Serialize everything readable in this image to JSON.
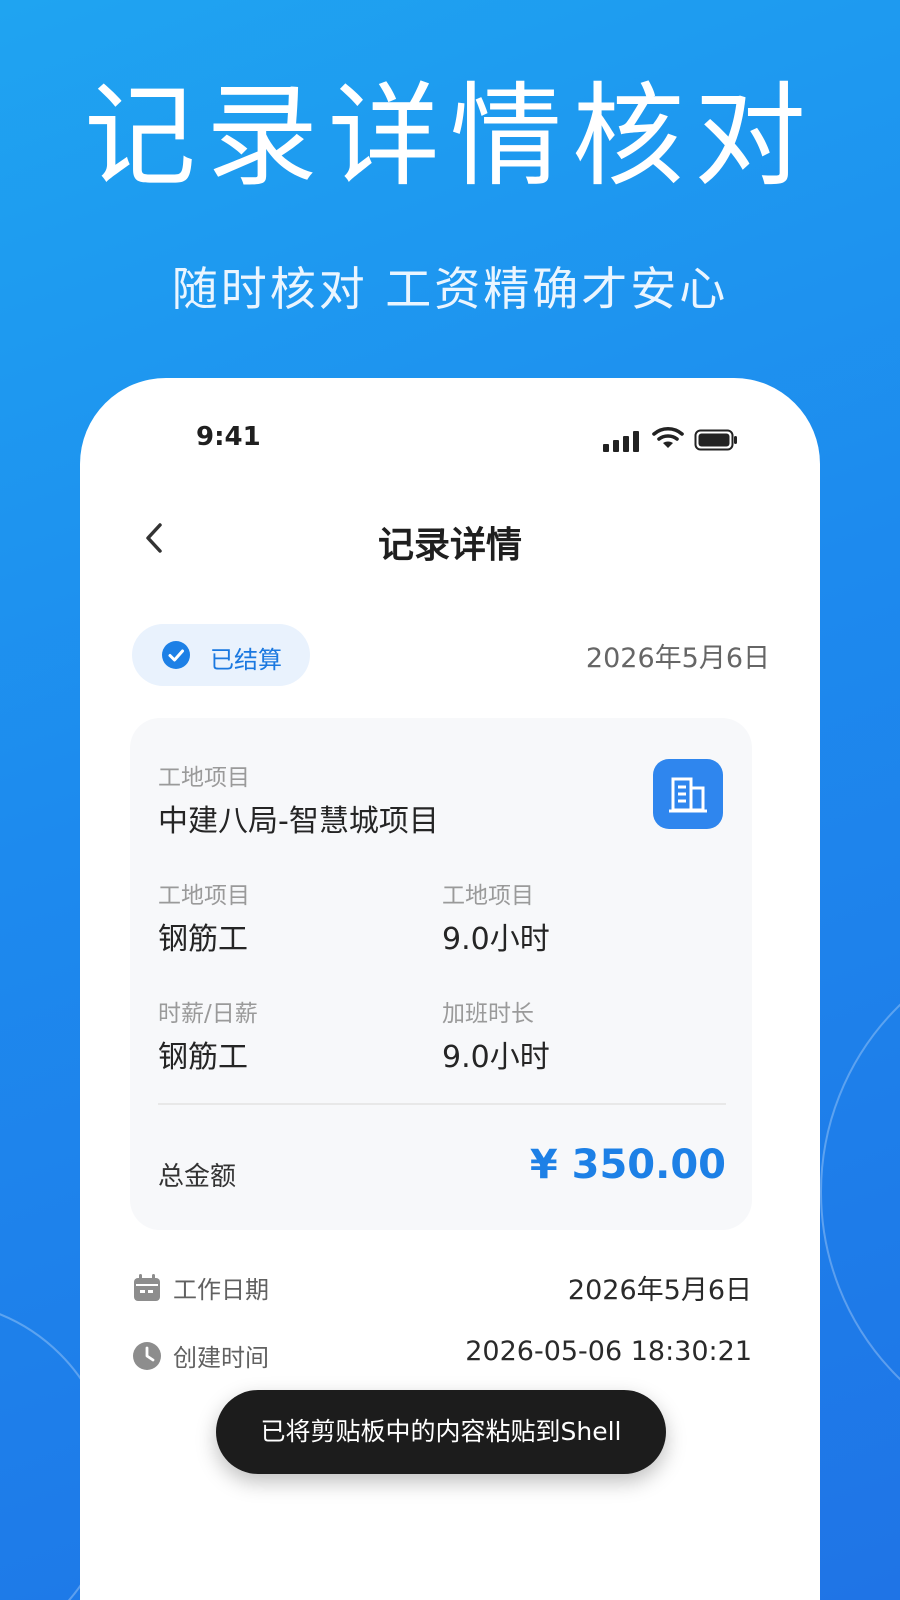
{
  "headline": "记录详情核对",
  "subheadline": "随时核对 工资精确才安心",
  "status_bar": {
    "time": "9:41",
    "icons": [
      "cellular-signal-icon",
      "wifi-icon",
      "battery-icon"
    ]
  },
  "nav": {
    "title": "记录详情",
    "back_icon": "chevron-left-icon"
  },
  "record": {
    "status_badge": "已结算",
    "status_icon": "check-circle-icon",
    "date": "2026年5月6日",
    "project_label": "工地项目",
    "project_name": "中建八局-智慧城项目",
    "project_icon": "building-icon",
    "fields": [
      {
        "label": "工地项目",
        "value": "钢筋工"
      },
      {
        "label": "工地项目",
        "value": "9.0小时"
      },
      {
        "label": "时薪/日薪",
        "value": "钢筋工"
      },
      {
        "label": "加班时长",
        "value": "9.0小时"
      }
    ],
    "total_label": "总金额",
    "total_value": "¥ 350.00"
  },
  "details": [
    {
      "icon": "calendar-icon",
      "label": "工作日期",
      "value": "2026年5月6日"
    },
    {
      "icon": "clock-icon",
      "label": "创建时间",
      "value": "2026-05-06 18:30:21"
    }
  ],
  "toast": {
    "message": "已将剪贴板中的内容粘贴到Shell"
  },
  "colors": {
    "background_top": "#1fa4f1",
    "background_bottom": "#1f74e6",
    "accent": "#1d80e6",
    "badge_background": "#e9f2fd",
    "card_background": "#f7f8fa",
    "toast_background": "#1c1c1c"
  }
}
